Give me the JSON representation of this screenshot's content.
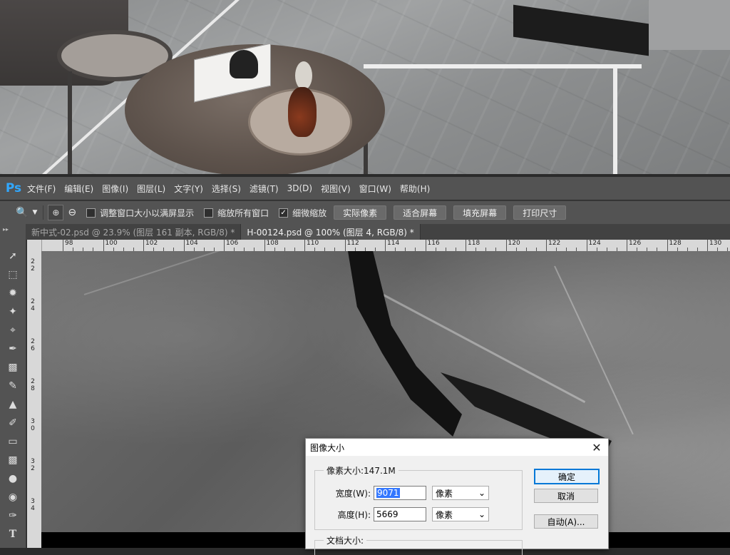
{
  "menubar": {
    "logo": "Ps",
    "items": [
      "文件(F)",
      "编辑(E)",
      "图像(I)",
      "图层(L)",
      "文字(Y)",
      "选择(S)",
      "滤镜(T)",
      "3D(D)",
      "视图(V)",
      "窗口(W)",
      "帮助(H)"
    ]
  },
  "options": {
    "resize_windows": "调整窗口大小以满屏显示",
    "zoom_all": "缩放所有窗口",
    "scrubby_zoom": "细微缩放",
    "scrubby_checked": true,
    "actual_pixels": "实际像素",
    "fit_screen": "适合屏幕",
    "fill_screen": "填充屏幕",
    "print_size": "打印尺寸"
  },
  "tabs": [
    {
      "label": "新中式-02.psd @ 23.9% (图层 161 副本, RGB/8) *",
      "active": false
    },
    {
      "label": "H-00124.psd @ 100% (图层 4, RGB/8) *",
      "active": true
    }
  ],
  "ruler_top": [
    "98",
    "100",
    "102",
    "104",
    "106",
    "108",
    "110",
    "112",
    "114",
    "116",
    "118",
    "120",
    "122",
    "124",
    "126",
    "128",
    "130"
  ],
  "ruler_left": [
    "2 2",
    "2 4",
    "2 6",
    "2 8",
    "3 0",
    "3 2",
    "3 4"
  ],
  "dialog": {
    "title": "图像大小",
    "pixel_size": "像素大小:147.1M",
    "width_label": "宽度(W):",
    "width_value": "9071",
    "height_label": "高度(H):",
    "height_value": "5669",
    "unit": "像素",
    "doc_size": "文档大小:",
    "ok": "确定",
    "cancel": "取消",
    "auto": "自动(A)..."
  }
}
